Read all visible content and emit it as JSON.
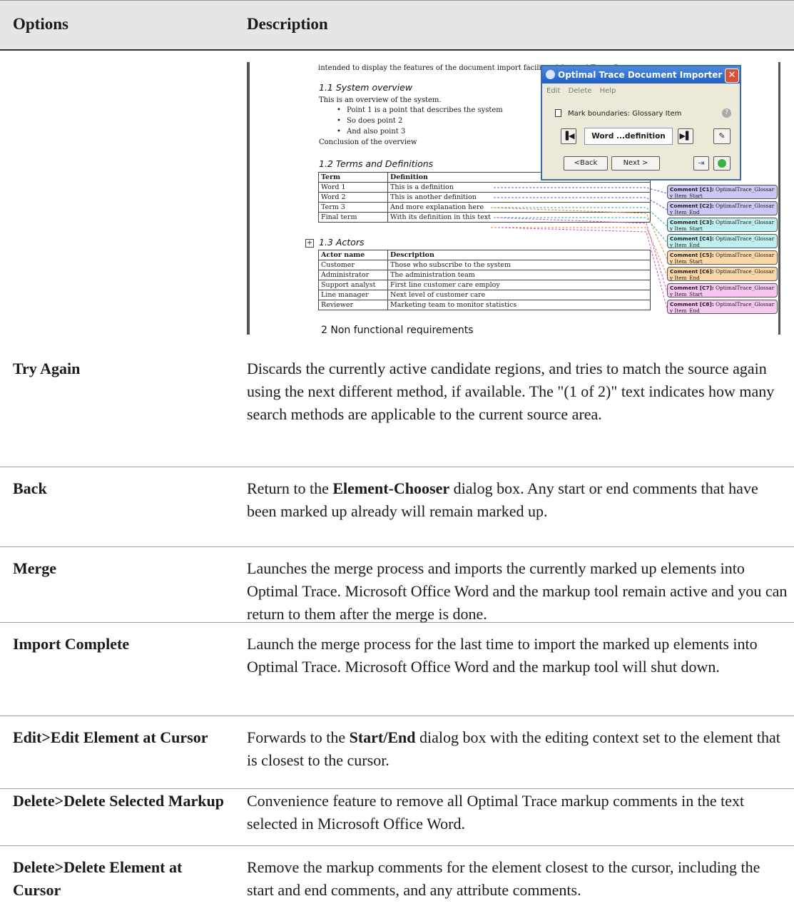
{
  "header": {
    "options": "Options",
    "description": "Description"
  },
  "screenshot": {
    "doc_intro": "intended to display the features of the document import facility of Optimal Trace 5",
    "section_11": "1.1  System overview",
    "overview": "This is an overview of the system.",
    "points": [
      "Point 1 is a point that describes the system",
      "So does point 2",
      "And also point 3"
    ],
    "conclusion": "Conclusion of the overview",
    "section_12": "1.2  Terms and Definitions",
    "terms_headers": [
      "Term",
      "Definition"
    ],
    "terms": [
      [
        "Word 1",
        "This is a definition"
      ],
      [
        "Word 2",
        "This is another definition"
      ],
      [
        "Term 3",
        "And more explanation here"
      ],
      [
        "Final term",
        "With its definition in this text"
      ]
    ],
    "section_13": "1.3  Actors",
    "actors_headers": [
      "Actor name",
      "Description"
    ],
    "actors": [
      [
        "Customer",
        "Those who subscribe to the system"
      ],
      [
        "Administrator",
        "The administration team"
      ],
      [
        "Support analyst",
        "First line customer care employ"
      ],
      [
        "Line manager",
        "Next level of customer care"
      ],
      [
        "Reviewer",
        "Marketing team to monitor statistics"
      ]
    ],
    "section_2": "2  Non functional requirements",
    "dialog": {
      "title": "Optimal Trace Document Importer",
      "menu": [
        "Edit",
        "Delete",
        "Help"
      ],
      "mark_label": "Mark boundaries: Glossary Item",
      "nav_value": "Word ...definition",
      "back": "<Back",
      "next": "Next >",
      "close": "✕"
    },
    "comments": [
      {
        "label": "Comment [C1]:",
        "line1": "OptimalTrace_Glossar",
        "line2": "y Item_Start",
        "color": "#c9c9f5"
      },
      {
        "label": "Comment [C2]:",
        "line1": "OptimalTrace_Glossar",
        "line2": "y Item_End",
        "color": "#c9c9f5"
      },
      {
        "label": "Comment [C3]:",
        "line1": "OptimalTrace_Glossar",
        "line2": "y Item_Start",
        "color": "#bff0f0"
      },
      {
        "label": "Comment [C4]:",
        "line1": "OptimalTrace_Glossar",
        "line2": "y Item_End",
        "color": "#bff0f0"
      },
      {
        "label": "Comment [C5]:",
        "line1": "OptimalTrace_Glossar",
        "line2": "y Item_Start",
        "color": "#fbd7a8"
      },
      {
        "label": "Comment [C6]:",
        "line1": "OptimalTrace_Glossar",
        "line2": "y Item_End",
        "color": "#fbd7a8"
      },
      {
        "label": "Comment [C7]:",
        "line1": "OptimalTrace_Glossar",
        "line2": "y Item_Start",
        "color": "#f6c7f0"
      },
      {
        "label": "Comment [C8]:",
        "line1": "OptimalTrace_Glossar",
        "line2": "y Item_End",
        "color": "#f6c7f0"
      }
    ]
  },
  "rows": [
    {
      "option": "Try Again",
      "description": "Discards the currently active candidate regions, and tries to match the source again using the next different method, if available. The \"(1 of 2)\" text indicates how many search methods are applicable to the current source area."
    },
    {
      "option": "Back",
      "description_parts": [
        "Return to the ",
        "Element-Chooser",
        " dialog box. Any start or end comments that have been marked up already will remain marked up."
      ]
    },
    {
      "option": "Merge",
      "description": "Launches the merge process and imports the currently marked up elements into Optimal Trace. Microsoft Office Word and the markup tool remain active and you can return to them after the merge is done."
    },
    {
      "option": "Import Complete",
      "description": "Launch the merge process for the last time to import the marked up elements into Optimal Trace. Microsoft Office Word and the markup tool will shut down."
    },
    {
      "option": "Edit>Edit Element at Cursor",
      "description_parts": [
        "Forwards to the ",
        "Start/End",
        " dialog box with the editing context set to the element that is closest to the cursor."
      ]
    },
    {
      "option": "Delete>Delete Selected Markup",
      "description": "Convenience feature to remove all Optimal Trace markup comments in the text selected in Microsoft Office Word."
    },
    {
      "option": "Delete>Delete Element at Cursor",
      "description": "Remove the markup comments for the element closest to the cursor, including the start and end comments, and any attribute comments."
    }
  ]
}
